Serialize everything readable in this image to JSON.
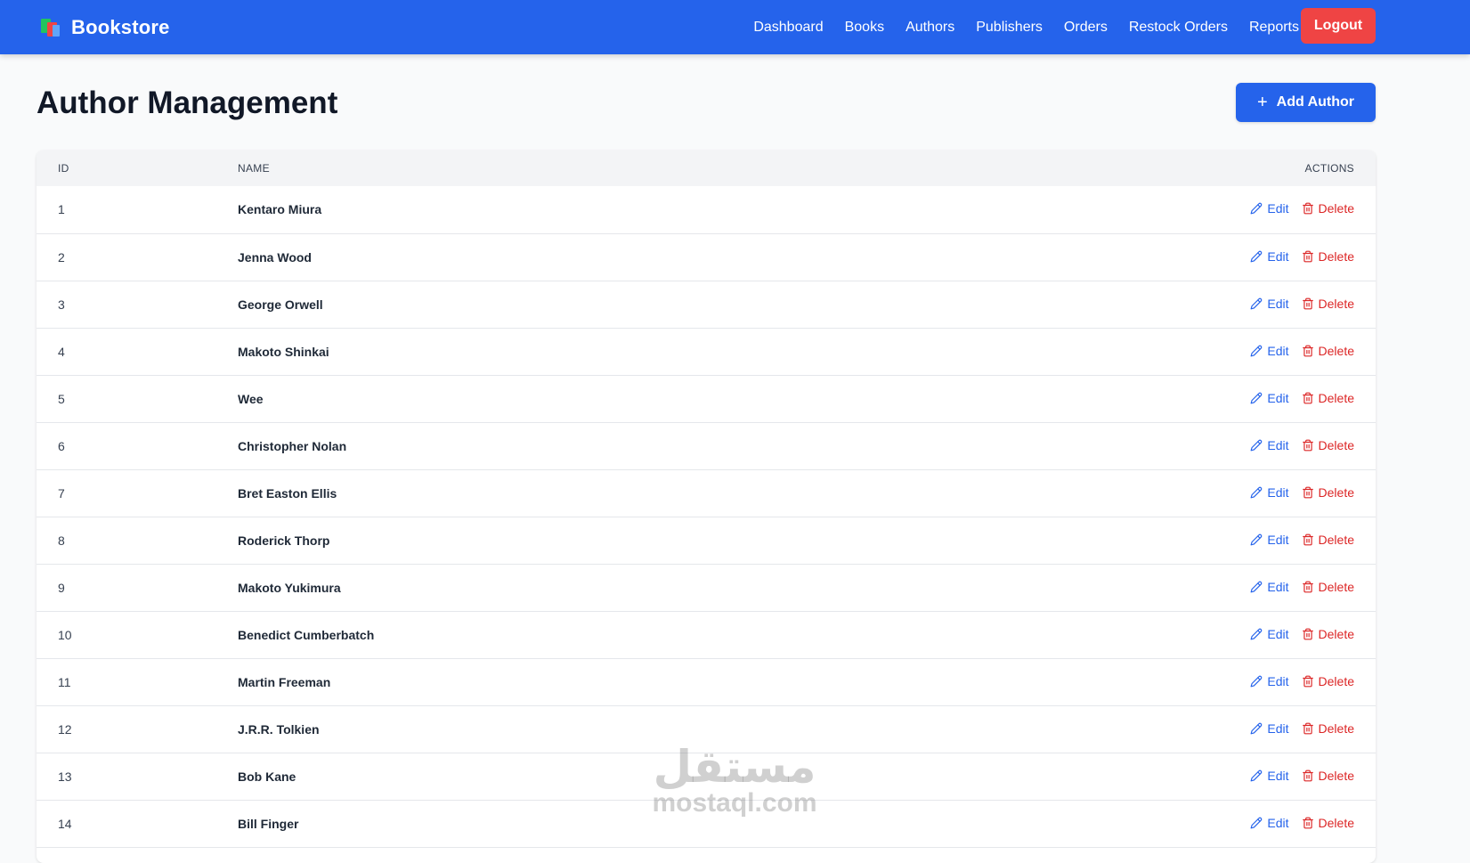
{
  "brand": {
    "name": "Bookstore",
    "icon": "books-icon"
  },
  "nav": {
    "links": [
      "Dashboard",
      "Books",
      "Authors",
      "Publishers",
      "Orders",
      "Restock Orders",
      "Reports"
    ],
    "logout_label": "Logout"
  },
  "page": {
    "title": "Author Management",
    "add_label": "Add Author"
  },
  "table": {
    "headers": {
      "id": "ID",
      "name": "Name",
      "actions": "Actions"
    },
    "edit_label": "Edit",
    "delete_label": "Delete",
    "rows": [
      {
        "id": "1",
        "name": "Kentaro Miura"
      },
      {
        "id": "2",
        "name": "Jenna Wood"
      },
      {
        "id": "3",
        "name": "George Orwell"
      },
      {
        "id": "4",
        "name": "Makoto Shinkai"
      },
      {
        "id": "5",
        "name": "Wee"
      },
      {
        "id": "6",
        "name": "Christopher Nolan"
      },
      {
        "id": "7",
        "name": "Bret Easton Ellis"
      },
      {
        "id": "8",
        "name": "Roderick Thorp"
      },
      {
        "id": "9",
        "name": "Makoto Yukimura"
      },
      {
        "id": "10",
        "name": "Benedict Cumberbatch"
      },
      {
        "id": "11",
        "name": "Martin Freeman"
      },
      {
        "id": "12",
        "name": "J.R.R. Tolkien"
      },
      {
        "id": "13",
        "name": "Bob Kane"
      },
      {
        "id": "14",
        "name": "Bill Finger"
      }
    ]
  },
  "watermark": {
    "arabic": "مستقل",
    "latin": "mostaql.com"
  },
  "colors": {
    "primary": "#2563eb",
    "danger": "#ef4444",
    "delete_text": "#dc2626"
  }
}
